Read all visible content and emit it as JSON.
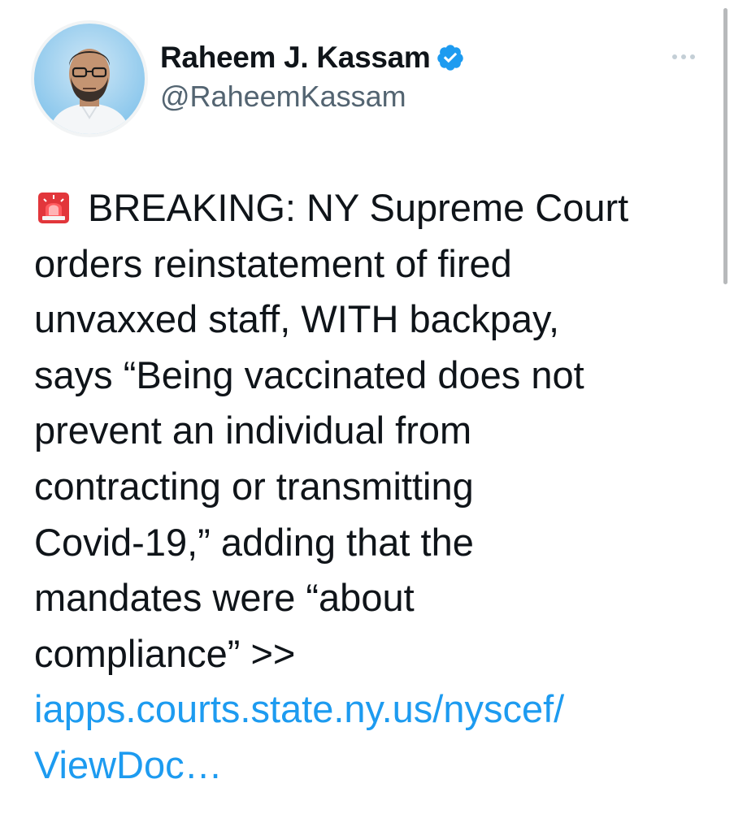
{
  "author": {
    "display_name": "Raheem J. Kassam",
    "handle": "@RaheemKassam",
    "verified": true,
    "avatar_icon": "profile-photo"
  },
  "tweet": {
    "emoji_icon": "police-car-light",
    "lines": [
      "BREAKING: NY Supreme Court",
      "orders reinstatement of fired",
      "unvaxxed staff, WITH backpay,",
      "says “Being vaccinated does not",
      "prevent an individual from",
      "contracting or transmitting",
      "Covid-19,” adding that the",
      "mandates were “about",
      "compliance” >>"
    ],
    "link_lines": [
      "iapps.courts.state.ny.us/nyscef/",
      "ViewDoc…"
    ]
  },
  "colors": {
    "text": "#0f1419",
    "secondary": "#536471",
    "link": "#1d9bf0",
    "verified_badge": "#1d9bf0"
  }
}
